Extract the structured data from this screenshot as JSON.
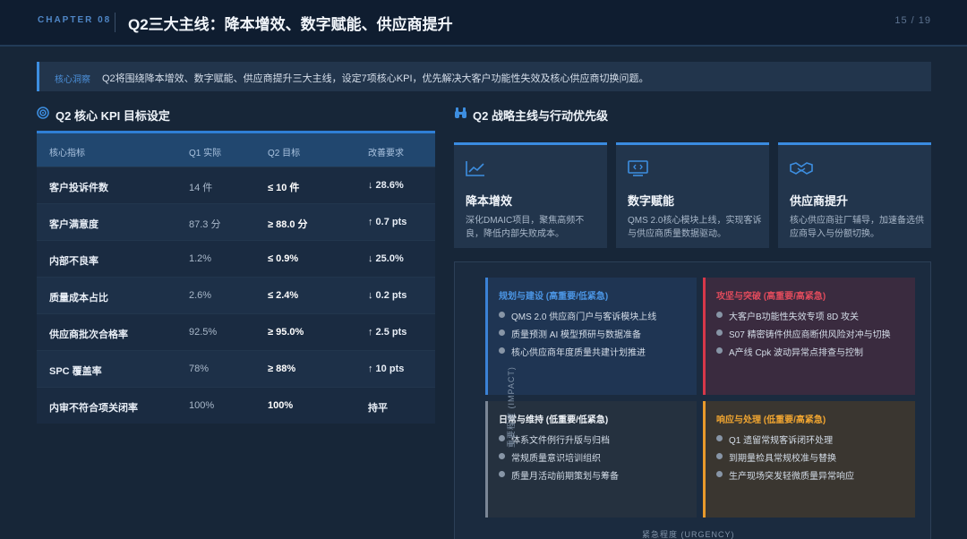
{
  "header": {
    "chapter": "CHAPTER 08",
    "title": "Q2三大主线：降本增效、数字赋能、供应商提升",
    "page": "15 / 19"
  },
  "insight": {
    "label": "核心洞察",
    "text": "Q2将围绕降本增效、数字赋能、供应商提升三大主线，设定7项核心KPI，优先解决大客户功能性失效及核心供应商切换问题。"
  },
  "kpi": {
    "title": "Q2 核心 KPI 目标设定",
    "columns": [
      "核心指标",
      "Q1 实际",
      "Q2 目标",
      "改善要求"
    ],
    "rows": [
      {
        "metric": "客户投诉件数",
        "q1": "14 件",
        "q2": "≤ 10 件",
        "req": "↓ 28.6%"
      },
      {
        "metric": "客户满意度",
        "q1": "87.3 分",
        "q2": "≥ 88.0 分",
        "req": "↑ 0.7 pts"
      },
      {
        "metric": "内部不良率",
        "q1": "1.2%",
        "q2": "≤ 0.9%",
        "req": "↓ 25.0%"
      },
      {
        "metric": "质量成本占比",
        "q1": "2.6%",
        "q2": "≤ 2.4%",
        "req": "↓ 0.2 pts"
      },
      {
        "metric": "供应商批次合格率",
        "q1": "92.5%",
        "q2": "≥ 95.0%",
        "req": "↑ 2.5 pts"
      },
      {
        "metric": "SPC 覆盖率",
        "q1": "78%",
        "q2": "≥ 88%",
        "req": "↑ 10 pts"
      },
      {
        "metric": "内审不符合项关闭率",
        "q1": "100%",
        "q2": "100%",
        "req": "持平"
      }
    ]
  },
  "strategy": {
    "title": "Q2 战略主线与行动优先级",
    "cards": [
      {
        "icon": "line-chart-icon",
        "title": "降本增效",
        "desc": "深化DMAIC项目，聚焦高频不良，降低内部失败成本。"
      },
      {
        "icon": "monitor-code-icon",
        "title": "数字赋能",
        "desc": "QMS 2.0核心模块上线，实现客诉与供应商质量数据驱动。"
      },
      {
        "icon": "handshake-icon",
        "title": "供应商提升",
        "desc": "核心供应商驻厂辅导，加速备选供应商导入与份额切换。"
      }
    ]
  },
  "matrix": {
    "y_axis": "重要程度 (IMPACT)",
    "x_axis": "紧急程度 (URGENCY)",
    "quadrants": {
      "plan": {
        "title": "规划与建设 (高重要/低紧急)",
        "items": [
          "QMS 2.0 供应商门户与客诉模块上线",
          "质量预测 AI 模型预研与数据准备",
          "核心供应商年度质量共建计划推进"
        ]
      },
      "attack": {
        "title": "攻坚与突破 (高重要/高紧急)",
        "items": [
          "大客户B功能性失效专项 8D 攻关",
          "S07 精密铸件供应商断供风险对冲与切换",
          "A产线 Cpk 波动异常点排查与控制"
        ]
      },
      "daily": {
        "title": "日常与维持 (低重要/低紧急)",
        "items": [
          "体系文件例行升版与归档",
          "常规质量意识培训组织",
          "质量月活动前期策划与筹备"
        ]
      },
      "resp": {
        "title": "响应与处理 (低重要/高紧急)",
        "items": [
          "Q1 遗留常规客诉闭环处理",
          "到期量检具常规校准与替换",
          "生产现场突发轻微质量异常响应"
        ]
      }
    },
    "colors": {
      "plan": "#4b95e4",
      "attack": "#e04b5c",
      "daily": "#eef2f7",
      "resp": "#f0a531"
    }
  }
}
